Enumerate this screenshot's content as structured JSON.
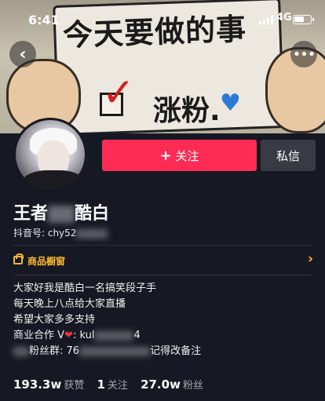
{
  "status_bar": {
    "time": "6:41",
    "network": "4G"
  },
  "cover": {
    "headline": "今天要做的事",
    "sign_text": "涨粉."
  },
  "actions": {
    "follow_label": "关注",
    "follow_plus": "+",
    "message_label": "私信"
  },
  "profile": {
    "name_prefix": "王者",
    "name_suffix": "酷白",
    "douyin_id_label": "抖音号: chy52"
  },
  "shop": {
    "label": "商品橱窗"
  },
  "bio": [
    {
      "text": "大家好我是酷白一名搞笑段子手"
    },
    {
      "text": "每天晚上八点给大家直播"
    },
    {
      "text": "希望大家多多支持"
    },
    {
      "prefix": "商业合作 V",
      "middle": ": kul",
      "suffix": "4"
    },
    {
      "prefix": "粉丝群: 76",
      "suffix": "记得改备注"
    }
  ],
  "stats": [
    {
      "value": "193.3w",
      "label": "获赞"
    },
    {
      "value": "1",
      "label": "关注"
    },
    {
      "value": "27.0w",
      "label": "粉丝"
    }
  ],
  "colors": {
    "background": "#161823",
    "follow": "#fe2c55",
    "message": "#393b44",
    "shop_accent": "#f9b72d"
  }
}
